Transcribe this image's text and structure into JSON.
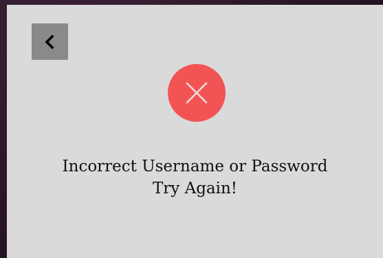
{
  "dialog": {
    "back_icon": "chevron-left-icon",
    "status_icon": "close-icon",
    "message_line_1": "Incorrect Username or Password",
    "message_line_2": "Try Again!"
  },
  "colors": {
    "background": "#2a1626",
    "dialog": "#dadada",
    "back_button": "#8a8a8a",
    "error": "#f25455",
    "text": "#111111"
  }
}
